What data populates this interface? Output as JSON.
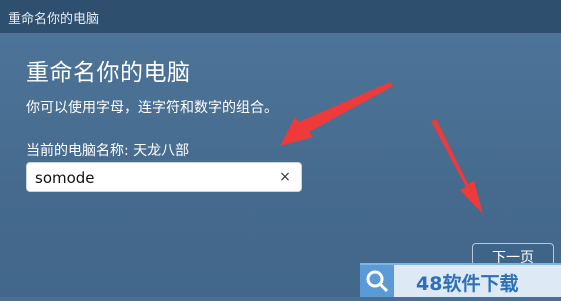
{
  "window": {
    "title": "重命名你的电脑"
  },
  "dialog": {
    "heading": "重命名你的电脑",
    "description": "你可以使用字母，连字符和数字的组合。",
    "current_name_label": "当前的电脑名称: 天龙八部",
    "name_input_value": "somode",
    "clear_glyph": "×",
    "next_label": "下一页"
  },
  "watermark": {
    "text": "48软件下载"
  },
  "colors": {
    "background": "#4a6f93",
    "titlebar": "#2f4f6f",
    "annotation_arrow": "#ee3a3a"
  },
  "icons": {
    "clear": "close-icon",
    "search": "search-icon"
  }
}
